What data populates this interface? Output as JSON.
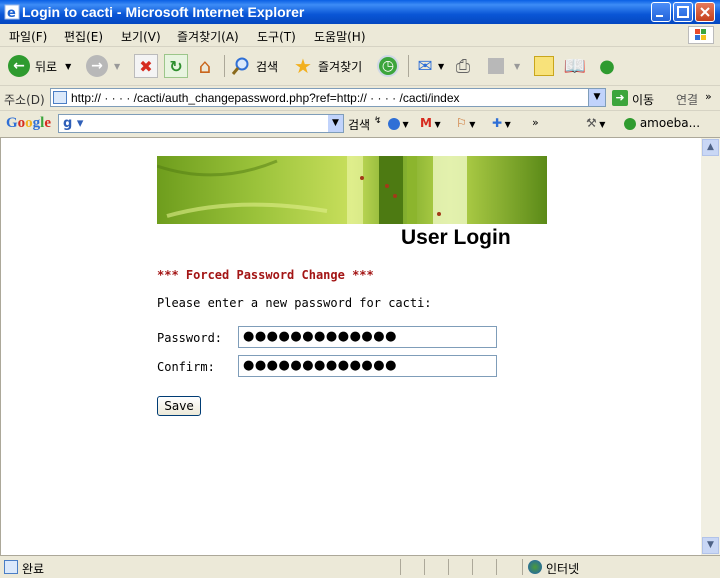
{
  "window": {
    "title": "Login to cacti - Microsoft Internet Explorer"
  },
  "menu": {
    "items": [
      "파일(F)",
      "편집(E)",
      "보기(V)",
      "즐겨찾기(A)",
      "도구(T)",
      "도움말(H)"
    ]
  },
  "toolbar": {
    "back_label": "뒤로",
    "search_label": "검색",
    "favorites_label": "즐겨찾기"
  },
  "address": {
    "label": "주소(D)",
    "url": "http://  ·  ·  ·   ·  /cacti/auth_changepassword.php?ref=http://   ·   ·   ·   ·  /cacti/index",
    "go_label": "이동",
    "links_label": "연결"
  },
  "google_bar": {
    "logo": "Google",
    "search_label": "검색",
    "account_label": "amoeba..."
  },
  "page": {
    "heading": "User Login",
    "forced_notice": "*** Forced Password Change ***",
    "prompt": "Please enter a new password for cacti:",
    "password_label": "Password:",
    "confirm_label": "Confirm:",
    "password_value": "●●●●●●●●●●●●●",
    "confirm_value": "●●●●●●●●●●●●●",
    "save_label": "Save"
  },
  "status": {
    "left": "완료",
    "zone": "인터넷"
  }
}
